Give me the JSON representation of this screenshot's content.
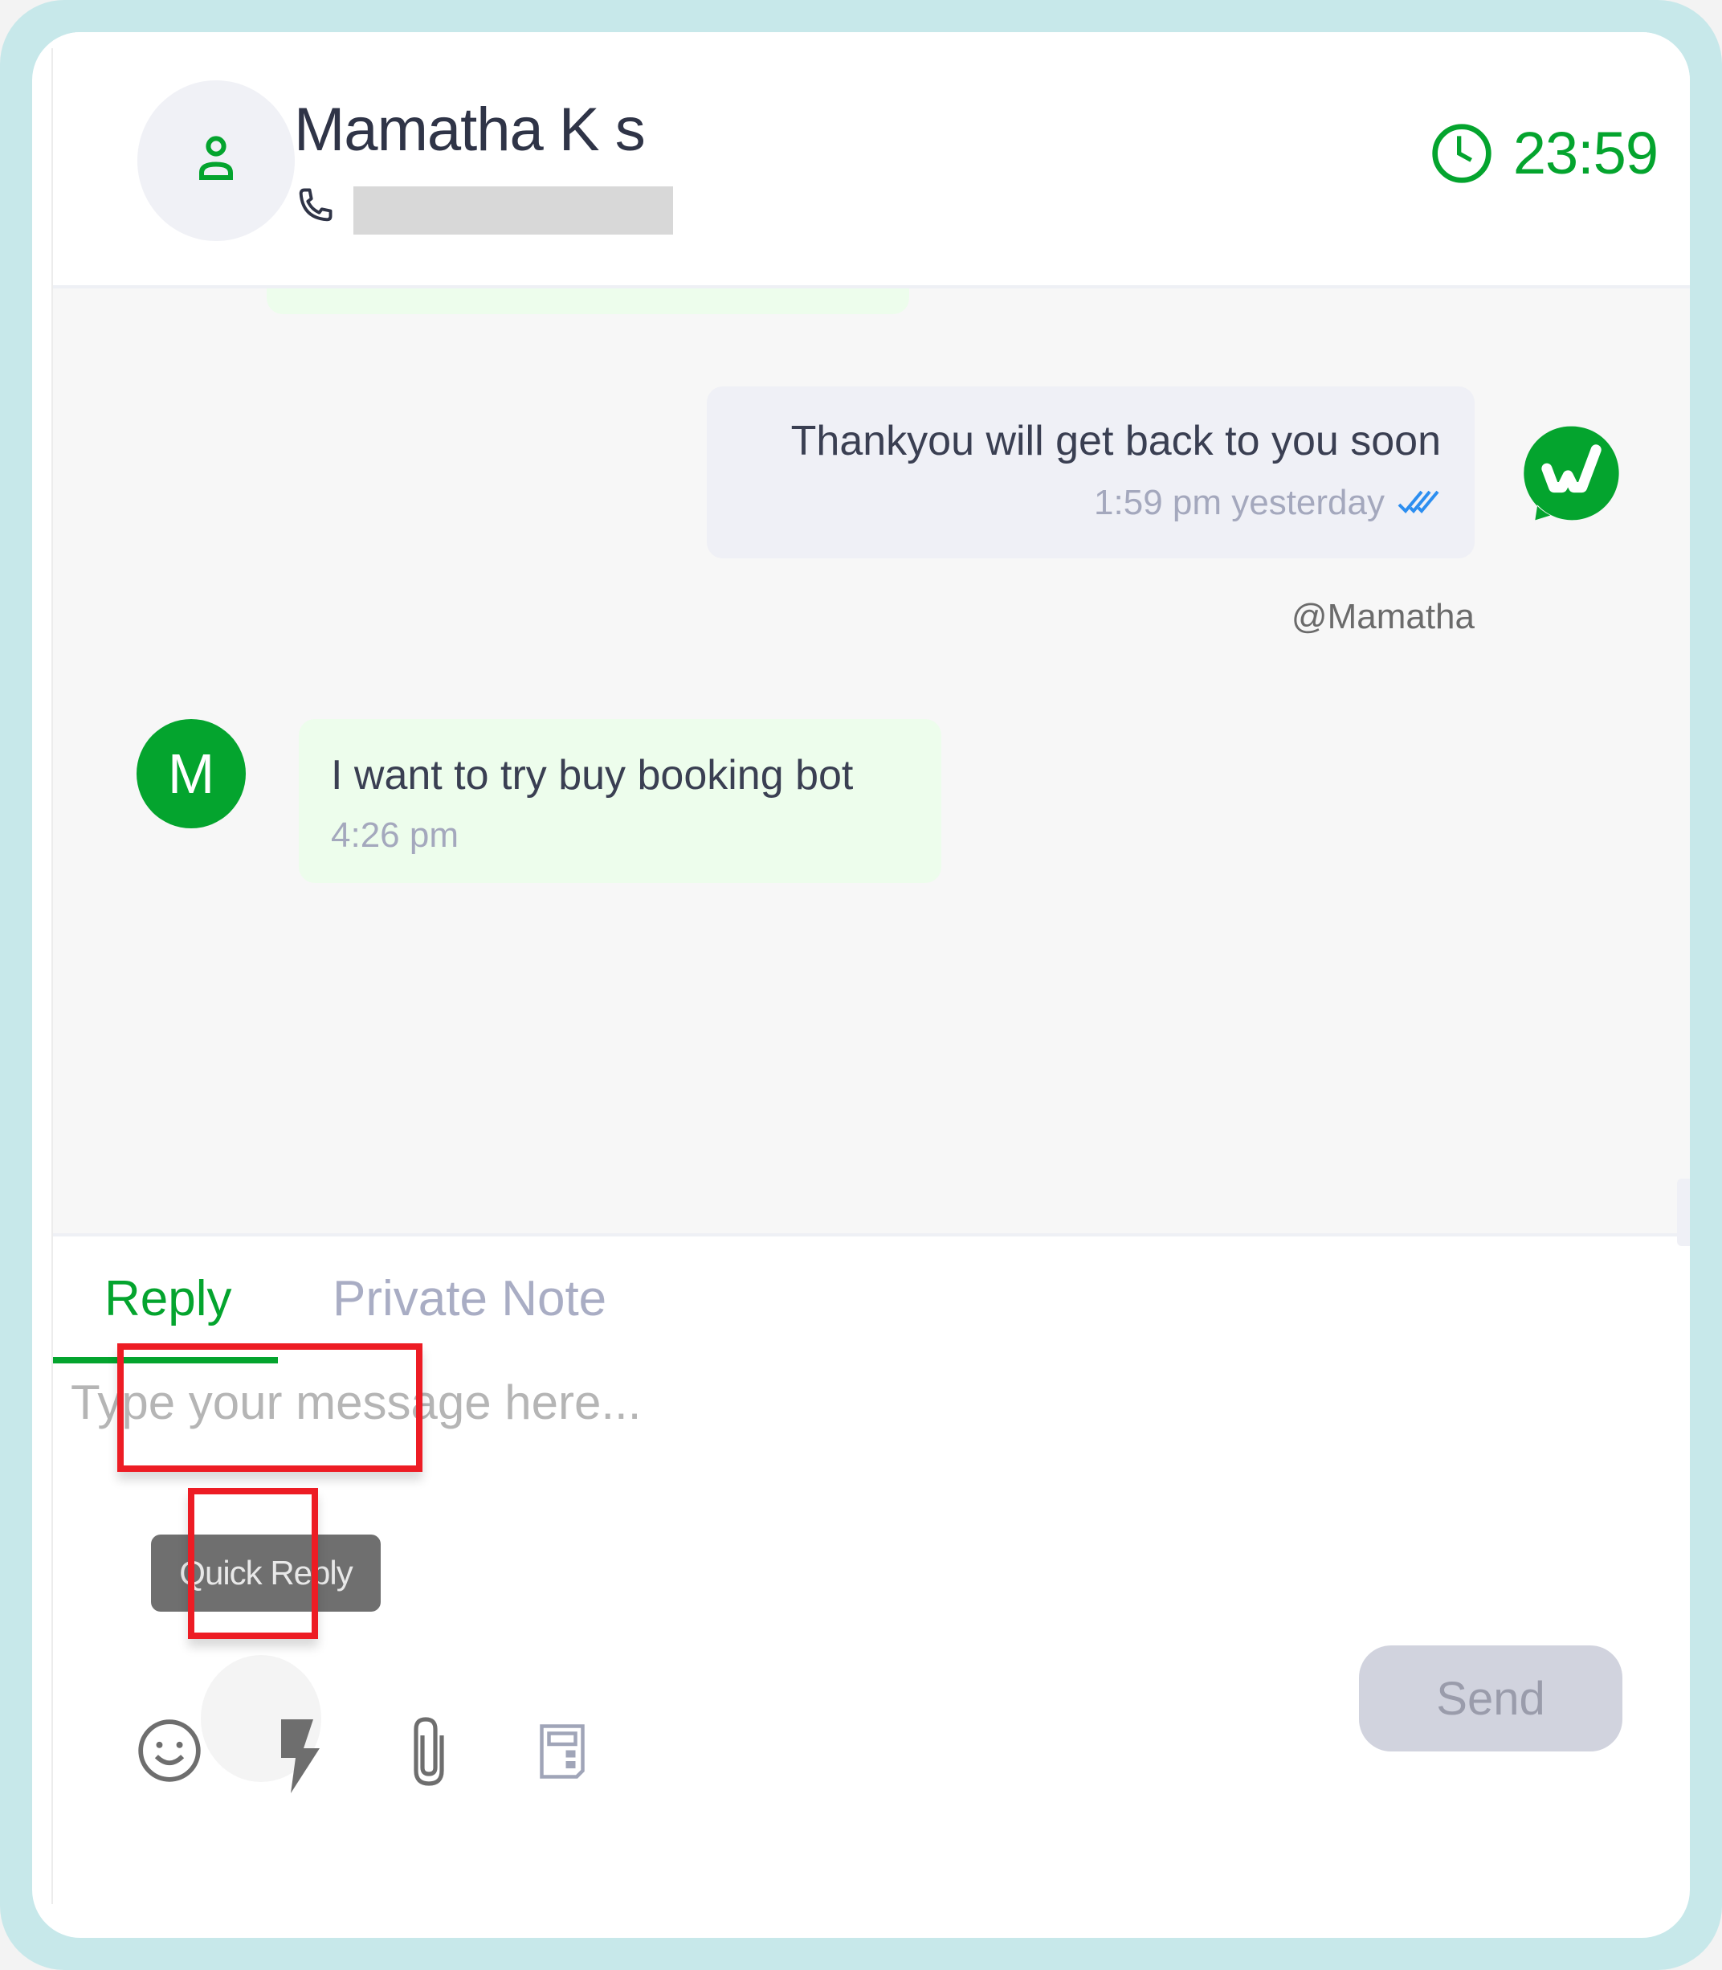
{
  "header": {
    "contact_name": "Mamatha K s",
    "avatar_icon": "user-icon",
    "phone_icon": "phone-icon",
    "phone_number": "",
    "timer_icon": "clock-icon",
    "timer_value": "23:59"
  },
  "messages": [
    {
      "direction": "outgoing",
      "text": "Thankyou will get back to you soon",
      "time": "1:59 pm yesterday",
      "status_icon": "double-check-icon",
      "agent": "@Mamatha",
      "channel_icon": "whatsapp-icon"
    },
    {
      "direction": "incoming",
      "avatar_initial": "M",
      "text": "I want to try buy booking bot",
      "time": "4:26 pm"
    }
  ],
  "composer": {
    "tabs": [
      {
        "label": "Reply",
        "active": true
      },
      {
        "label": "Private Note",
        "active": false
      }
    ],
    "placeholder": "Type your message here...",
    "value": "",
    "tooltip": "Quick Reply",
    "tools": [
      "emoji-icon",
      "quick-reply-icon",
      "attachment-icon",
      "template-icon"
    ],
    "send_label": "Send"
  },
  "colors": {
    "accent": "#04a42e",
    "frame": "#c7e8ea",
    "highlight": "#ed1c24",
    "incoming_bubble": "#edfdec",
    "outgoing_bubble": "#eff0f6",
    "send_disabled": "#d1d3de"
  }
}
